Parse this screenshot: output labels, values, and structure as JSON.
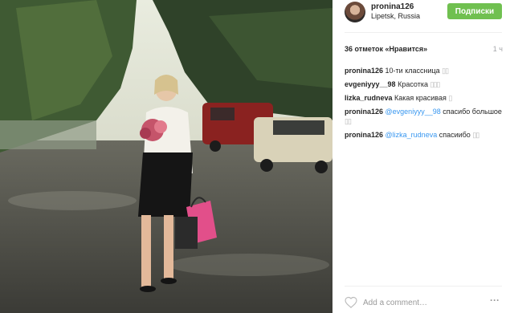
{
  "post": {
    "photo_alt": "photo",
    "header": {
      "username": "pronina126",
      "location": "Lipetsk, Russia",
      "follow_label": "Подписки"
    },
    "likes_text": "36 отметок «Нравится»",
    "time_ago": "1 ч",
    "comments": [
      {
        "author": "pronina126",
        "mention": "",
        "text": "10-ти классница",
        "emoji": "▯▯"
      },
      {
        "author": "evgeniyyy__98",
        "mention": "",
        "text": "Красотка",
        "emoji": "▯▯▯"
      },
      {
        "author": "lizka_rudneva",
        "mention": "",
        "text": "Какая красивая",
        "emoji": "▯"
      },
      {
        "author": "pronina126",
        "mention": "@evgeniyyy__98",
        "text": "спасибо большое",
        "emoji": "▯▯"
      },
      {
        "author": "pronina126",
        "mention": "@lizka_rudneva",
        "text": "спасиибо",
        "emoji": "▯▯"
      }
    ],
    "add_comment_placeholder": "Add a comment…",
    "more_label": "···"
  },
  "colors": {
    "follow_button": "#70c050",
    "mention": "#3897f0",
    "muted": "#a5a7aa"
  },
  "icons": {
    "like": "heart-icon",
    "more": "more-options-icon"
  }
}
